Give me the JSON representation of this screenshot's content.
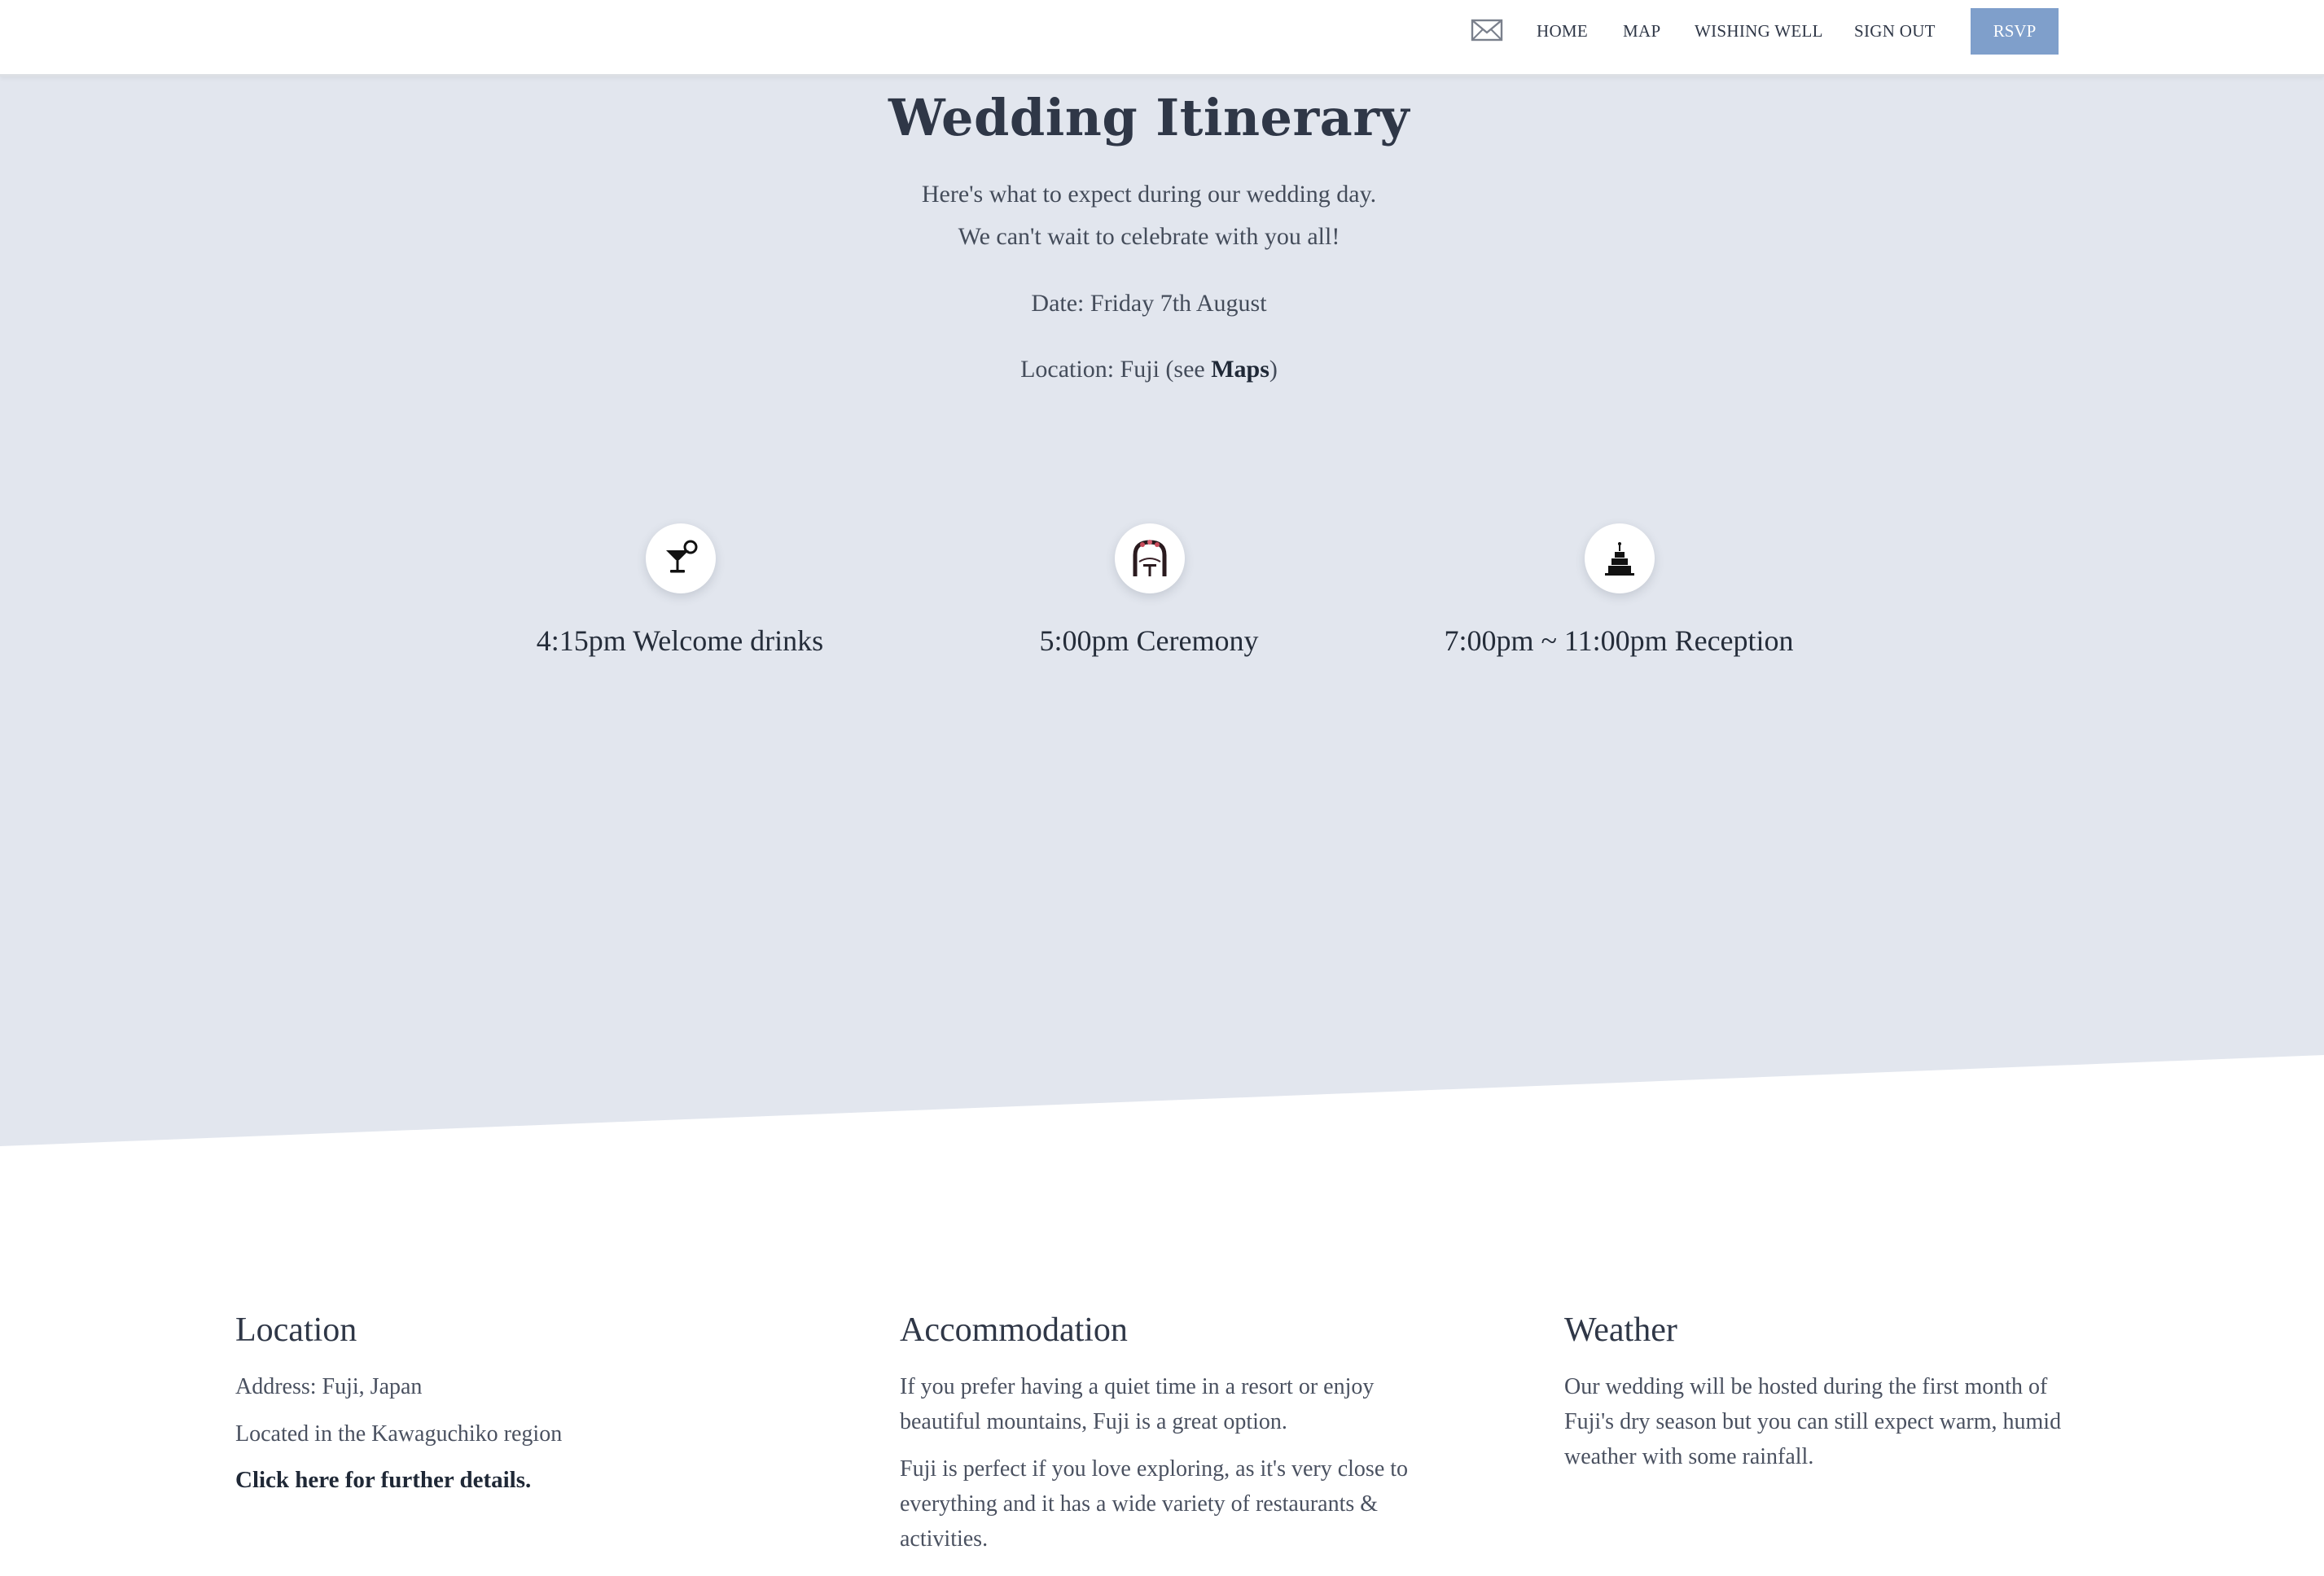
{
  "nav": {
    "mail_icon": "envelope-icon",
    "links": [
      "HOME",
      "MAP",
      "WISHING WELL",
      "SIGN OUT"
    ],
    "rsvp_label": "RSVP",
    "rsvp_color": "#7f9fcb"
  },
  "hero": {
    "title": "Wedding Itinerary",
    "intro_line1": "Here's what to expect during our wedding day.",
    "intro_line2": "We can't wait to celebrate with you all!",
    "date": "Date: Friday 7th August",
    "location_prefix": "Location: Fuji (see ",
    "location_link": "Maps",
    "location_suffix": ")",
    "background_color": "#e2e6ee"
  },
  "events": [
    {
      "icon": "cocktail-icon",
      "label": "4:15pm Welcome drinks"
    },
    {
      "icon": "wedding-arch-icon",
      "label": "5:00pm Ceremony"
    },
    {
      "icon": "wedding-cake-icon",
      "label": "7:00pm ~ 11:00pm Reception"
    }
  ],
  "info": {
    "location": {
      "title": "Location",
      "address": "Address: Fuji, Japan",
      "region": "Located in the Kawaguchiko region",
      "link": "Click here for further details."
    },
    "accommodation": {
      "title": "Accommodation",
      "para1": "If you prefer having a quiet time in a resort or enjoy beautiful mountains, Fuji is a great option.",
      "para2": "Fuji is perfect if you love exploring, as it's very close to everything and it has a wide variety of restaurants & activities."
    },
    "weather": {
      "title": "Weather",
      "para1": "Our wedding will be hosted during the first month of Fuji's dry season but you can still expect warm, humid weather with some rainfall."
    }
  }
}
